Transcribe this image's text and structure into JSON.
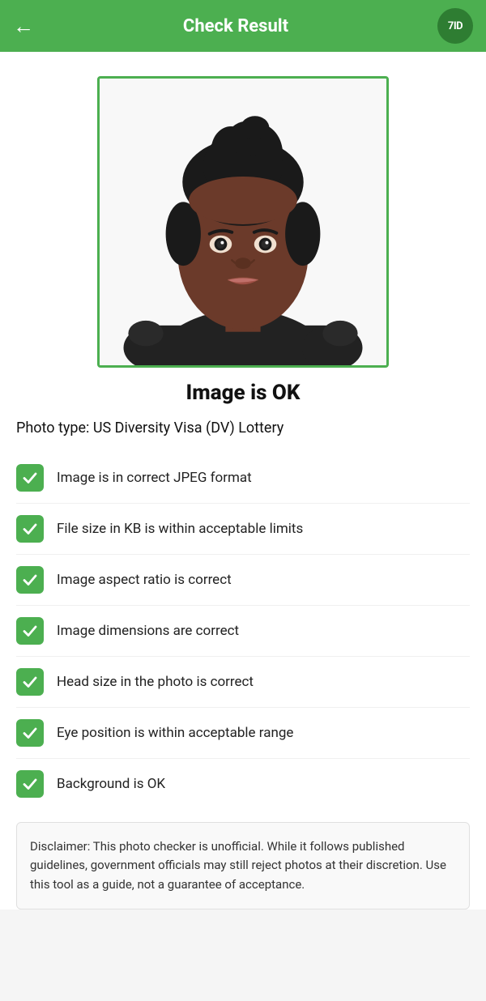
{
  "header": {
    "title": "Check Result",
    "back_label": "←",
    "logo_text": "7ID"
  },
  "result": {
    "title": "Image is OK",
    "photo_type_label": "Photo type: US Diversity Visa (DV) Lottery"
  },
  "checks": [
    {
      "id": "jpeg",
      "text": "Image is in correct JPEG format",
      "passed": true
    },
    {
      "id": "filesize",
      "text": "File size in KB is within acceptable limits",
      "passed": true
    },
    {
      "id": "aspect",
      "text": "Image aspect ratio is correct",
      "passed": true
    },
    {
      "id": "dimensions",
      "text": "Image dimensions are correct",
      "passed": true
    },
    {
      "id": "headsize",
      "text": "Head size in the photo is correct",
      "passed": true
    },
    {
      "id": "eyepos",
      "text": "Eye position is within acceptable range",
      "passed": true
    },
    {
      "id": "background",
      "text": "Background is OK",
      "passed": true
    }
  ],
  "disclaimer": {
    "text": "Disclaimer: This photo checker is unofficial. While it follows published guidelines, government officials may still reject photos at their discretion. Use this tool as a guide, not a guarantee of acceptance."
  }
}
